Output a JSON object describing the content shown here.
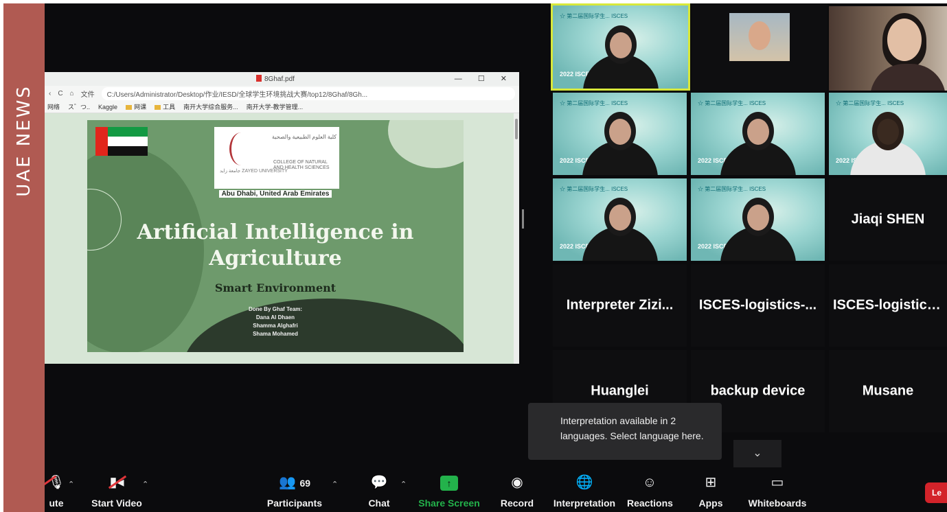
{
  "banner": {
    "label": "UAE NEWS"
  },
  "pdf": {
    "tab_title": "8Ghaf.pdf",
    "window_controls": "— ☐ ✕",
    "nav": [
      "‹",
      "C",
      "⌂"
    ],
    "file_label": "文件",
    "url": "C:/Users/Administrator/Desktop/作业/IESD/全球学生环境挑战大赛/top12/8Ghaf/8Gh...",
    "bookmarks": [
      "网络",
      "ス゛つ..",
      "Kaggle",
      "网课",
      "工具",
      "南开大学综合服务...",
      "南开大学-教学管理..."
    ]
  },
  "slide": {
    "logo_arabic": "كلية العلوم الطبيعية والصحية",
    "logo_english": "COLLEGE OF NATURAL AND HEALTH SCIENCES",
    "logo_university": "جامعة زايد ZAYED UNIVERSITY",
    "location": "Abu Dhabi, United Arab Emirates",
    "title_line1": "Artificial Intelligence in",
    "title_line2": "Agriculture",
    "subtitle": "Smart Environment",
    "credits": [
      "Done By Ghaf Team:",
      "Dana Al Dhaen",
      "Shamma Alghafri",
      "Shama Mohamed"
    ]
  },
  "gallery": {
    "video_tag": "☆ 第二届国际学生... ISCES",
    "video_year": "2022 ISCES",
    "names": {
      "jiaqi": "Jiaqi SHEN",
      "interpreter": "Interpreter  Zizi...",
      "logistics1": "ISCES-logistics-...",
      "logistics2": "ISCES-logistics-...",
      "huanglei": "Huanglei",
      "backup": "backup device",
      "musane": "Musane"
    }
  },
  "tooltip": {
    "text": "Interpretation available in 2 languages. Select language here."
  },
  "expand": {
    "icon": "chevron-down"
  },
  "toolbar": {
    "mute": "ute",
    "start_video": "Start Video",
    "participants": "Participants",
    "participants_count": "69",
    "chat": "Chat",
    "share_screen": "Share Screen",
    "record": "Record",
    "interpretation": "Interpretation",
    "reactions": "Reactions",
    "apps": "Apps",
    "whiteboards": "Whiteboards",
    "leave": "Le"
  },
  "colors": {
    "share_green": "#23b24b",
    "highlight": "#d8e83a",
    "leave_red": "#d3232a",
    "banner": "#b05a52"
  }
}
